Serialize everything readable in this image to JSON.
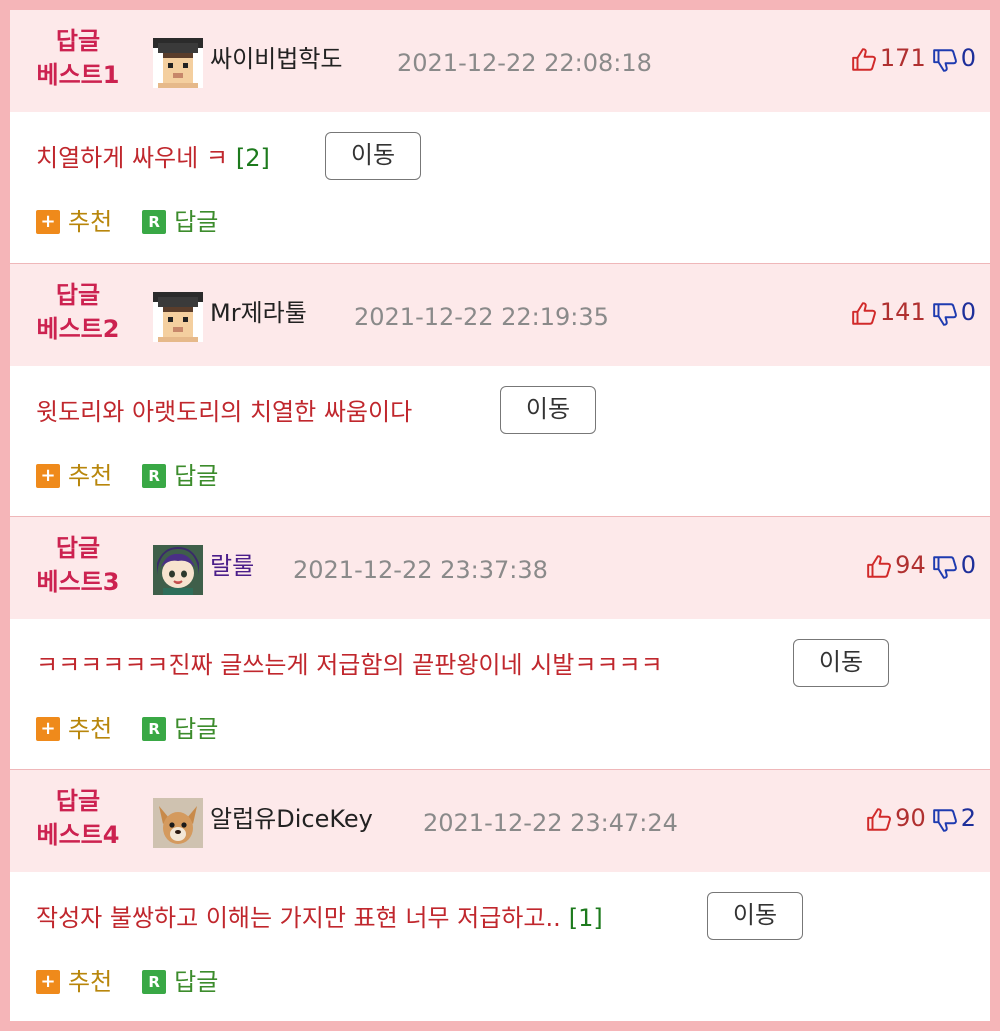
{
  "ui": {
    "move_label": "이동",
    "recommend_label": "추천",
    "reply_label": "답글",
    "plus_glyph": "+",
    "reply_glyph": "R"
  },
  "colors": {
    "frame": "#f5b5b8",
    "header_bg": "#fde9ea",
    "rank": "#cc2250",
    "comment_text": "#c0272d",
    "count": "#1d7a1d",
    "upvote": "#b03030",
    "downvote": "#1e2f9a"
  },
  "entries": [
    {
      "rank_line1": "답글",
      "rank_line2": "베스트1",
      "nickname": "싸이비법학도",
      "avatar": "pixel-graduate-avatar",
      "datetime": "2021-12-22 22:08:18",
      "up": "171",
      "down": "0",
      "text": "치열하게 싸우네 ㅋ",
      "reply_count": "[2]"
    },
    {
      "rank_line1": "답글",
      "rank_line2": "베스트2",
      "nickname": "Mr제라툴",
      "avatar": "pixel-graduate-avatar",
      "datetime": "2021-12-22 22:19:35",
      "up": "141",
      "down": "0",
      "text": "윗도리와 아랫도리의 치열한 싸움이다",
      "reply_count": ""
    },
    {
      "rank_line1": "답글",
      "rank_line2": "베스트3",
      "nickname": "랄룰",
      "avatar": "anime-character-avatar",
      "datetime": "2021-12-22 23:37:38",
      "up": "94",
      "down": "0",
      "text": "ㅋㅋㅋㅋㅋㅋ진짜 글쓰는게 저급함의 끝판왕이네 시발ㅋㅋㅋㅋ",
      "reply_count": ""
    },
    {
      "rank_line1": "답글",
      "rank_line2": "베스트4",
      "nickname": "알럽유DiceKey",
      "avatar": "dog-photo-avatar",
      "datetime": "2021-12-22 23:47:24",
      "up": "90",
      "down": "2",
      "text": "작성자 불쌍하고 이해는 가지만 표현 너무 저급하고..",
      "reply_count": "[1]"
    }
  ]
}
